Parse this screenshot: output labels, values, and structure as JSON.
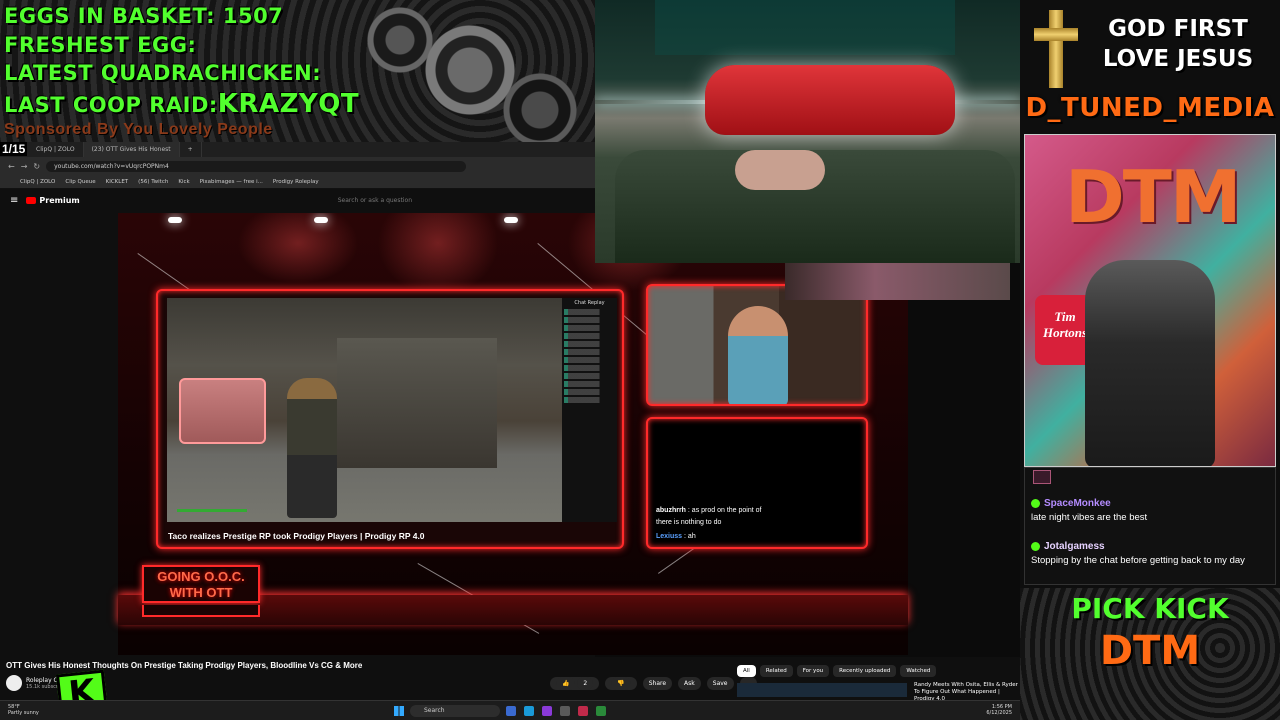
{
  "overlay": {
    "stats": {
      "eggs_label": "EGGS IN BASKET:",
      "eggs_value": "1507",
      "freshest_label": "FRESHEST EGG:",
      "quadrachicken_label": "LATEST QUADRACHICKEN:",
      "raid_label": "LAST COOP RAID:",
      "raid_value": "KRAZYQT",
      "sponsor": "Sponsored By You Lovely People"
    },
    "slide_counter": "1/15",
    "faith_line1": "GOD FIRST",
    "faith_line2": "LOVE JESUS",
    "brand": "D_TUNED_MEDIA",
    "roomcam_sign_text": "DTM",
    "roomcam_cafe_sign": "Tim Hortons",
    "pick_kick": "PICK KICK",
    "pick_kick_name": "DTM",
    "kick_logo_letter": "K"
  },
  "chat": {
    "messages": [
      {
        "user": "SpaceMonkee",
        "text": "late night vibes are the best"
      },
      {
        "user": "Jotalgamess",
        "text": "Stopping by the chat before getting back to my day"
      }
    ]
  },
  "browser": {
    "tabs": [
      {
        "label": "ClipQ | ZOLO"
      },
      {
        "label": "(23) OTT Gives His Honest",
        "active": true
      }
    ],
    "url": "youtube.com/watch?v=vUqrcPOPNm4",
    "bookmarks": [
      "ClipQ | ZOLO",
      "Clip Queue",
      "KICKLET",
      "(56) Twitch",
      "Kick",
      "Pixabimages — free i...",
      "Prodigy Roleplay"
    ],
    "youtube_brand": "Premium",
    "search_placeholder": "Search or ask a question"
  },
  "video": {
    "embedded_title": "Taco realizes Prestige RP took Prodigy Players | Prodigy RP 4.0",
    "chat_replay_title": "Chat Replay",
    "stream_chat": [
      {
        "user": "abuzhrrh",
        "text": ": as prod on the point of"
      },
      {
        "user": "",
        "text": "there is nothing to do"
      },
      {
        "user": "Lexiuss",
        "text": ": ah"
      }
    ],
    "ooc_banner": "GOING O.O.C. WITH OTT"
  },
  "youtube_below": {
    "title": "OTT Gives His Honest Thoughts On Prestige Taking Prodigy Players, Bloodline Vs CG & More",
    "channel": "Roleplay Cli",
    "subs": "15.1k subscribers",
    "like_count": "2",
    "actions": [
      "Share",
      "Ask",
      "Save",
      "..."
    ],
    "chips": [
      {
        "label": "All",
        "selected": true
      },
      {
        "label": "Related"
      },
      {
        "label": "For you"
      },
      {
        "label": "Recently uploaded"
      },
      {
        "label": "Watched"
      }
    ],
    "related_title": "Randy Meets With Osita, Ellis & Ryder To Figure Out What Happened | Prodigy 4.0"
  },
  "taskbar": {
    "weather_temp": "58°F",
    "weather_desc": "Partly sunny",
    "search_label": "Search",
    "time": "1:56 PM",
    "date": "6/12/2025"
  },
  "colors": {
    "neon_red": "#ff2a2a",
    "kick_green": "#53fc18",
    "stat_green": "#52ff2e",
    "brand_orange": "#ff6a14"
  }
}
